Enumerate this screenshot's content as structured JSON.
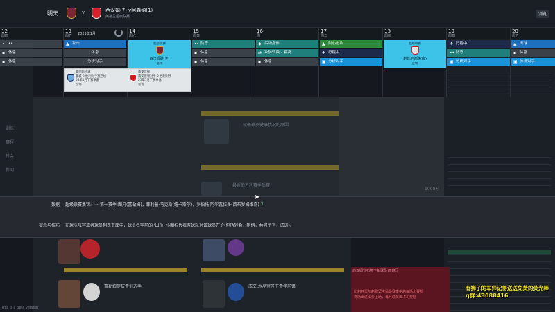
{
  "header": {
    "day": "明天",
    "vs": "v",
    "match_title": "西汉姆(7) v阿森纳(1)",
    "competition": "英格兰超级联赛",
    "browse": "浏览"
  },
  "calendar": {
    "month": "2023年1月",
    "days": [
      {
        "date": "12",
        "weekday": "周四"
      },
      {
        "date": "13",
        "weekday": "周五"
      },
      {
        "date": "14",
        "weekday": "周六"
      },
      {
        "date": "15",
        "weekday": "周日"
      },
      {
        "date": "16",
        "weekday": "周一"
      },
      {
        "date": "17",
        "weekday": "周二"
      },
      {
        "date": "18",
        "weekday": "周三"
      },
      {
        "date": "19",
        "weekday": "周四"
      },
      {
        "date": "20",
        "weekday": "周五"
      }
    ],
    "chips": {
      "d12": [
        "••",
        "休息",
        "休息"
      ],
      "d13": [
        "攻击",
        "休息",
        "分析对手"
      ],
      "d15": [
        "防守",
        "休息",
        "休息"
      ],
      "d16": [
        "后场身体",
        "攻防转换 - 紧凑",
        "休息"
      ],
      "d17": [
        "耐心进攻",
        "行程中",
        "分析对手"
      ],
      "d19": [
        "行程中",
        "防守",
        "分析对手"
      ],
      "d20": [
        "出球",
        "休息",
        "分析对手"
      ]
    },
    "match14": {
      "comp": "超级联赛",
      "name": "西汉姆联(主)",
      "sub": "客场"
    },
    "match18": {
      "comp": "超级联赛",
      "name": "谢菲尔德联(客)",
      "sub": "主场"
    },
    "popup": {
      "left": [
        "曼彻斯特城",
        "曼城 2 胜利对手赛后续",
        "23年1月下赛季备",
        "全场"
      ],
      "right": [
        "南安普顿",
        "南安普顿对手 2 胜利对手",
        "23年1月下赛季备",
        "客场"
      ]
    }
  },
  "infobar": {
    "data_label": "数据",
    "data_text": "超级联赛集锦: ~~第一赛季:图凡(富勒姆)，菲利普·马克斯(纽卡斯尔)，罗伯托·阿尔瓦拉多(西布罗姆维奇)",
    "data_count": "7",
    "tips_label": "提示与技巧",
    "tips_text": "在球队阵容或者球员列表页面中，球员名字前的 '出价' 小图标代表有球队对该球员开价(包括转会，租借，共同所有，试训)。"
  },
  "background": {
    "news1": "权衡球员健康状况的原因",
    "news2": "最近伯方利赛季后赛",
    "news3": "富勒姆提拔青训选手",
    "news4": "成交:水晶宫签下青年前锋",
    "tag1": "训练",
    "tag2": "赛程",
    "tag3": "转会",
    "tag4": "新闻",
    "value1": "1000万"
  },
  "chat": {
    "head": "西汉姆宣布签下新球员 西班牙",
    "lines": [
      "比利亚雷尔的穆罕主留最赛季中的每场比赛都",
      "将场出进比价上场，每月球员(5.43)交易"
    ]
  },
  "stream": {
    "line1": "有狮子的军师记得送送免费的荧光棒",
    "line2": "q群:43088416"
  },
  "beta": "This is a beta version"
}
